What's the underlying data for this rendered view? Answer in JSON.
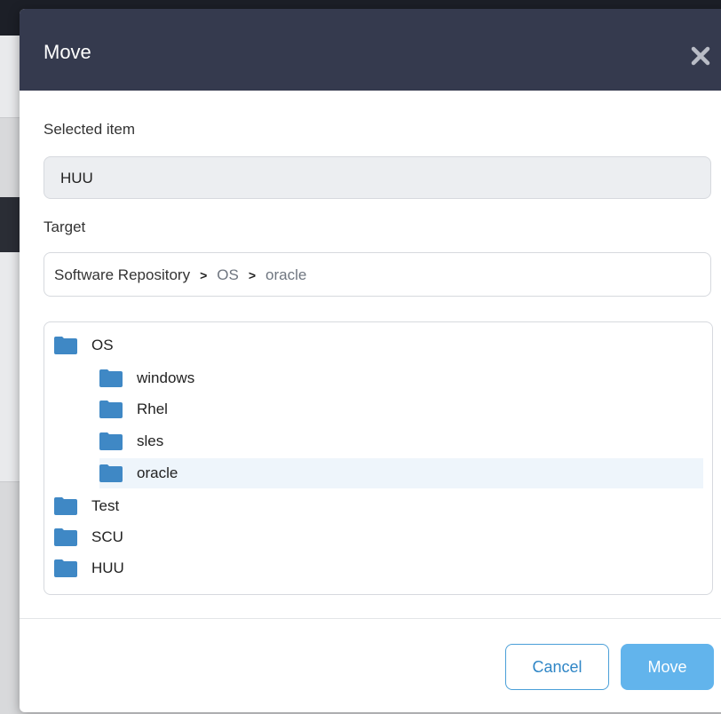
{
  "dialog": {
    "title": "Move",
    "close_icon": "close-icon"
  },
  "selected_item": {
    "label": "Selected item",
    "value": "HUU"
  },
  "target": {
    "label": "Target",
    "breadcrumb": [
      "Software Repository",
      "OS",
      "oracle"
    ],
    "separator": ">"
  },
  "tree": {
    "items": [
      {
        "label": "OS",
        "level": 0
      },
      {
        "label": "windows",
        "level": 1
      },
      {
        "label": "Rhel",
        "level": 1
      },
      {
        "label": "sles",
        "level": 1
      },
      {
        "label": "oracle",
        "level": 1,
        "selected": true
      },
      {
        "label": "Test",
        "level": 0
      },
      {
        "label": "SCU",
        "level": 0
      },
      {
        "label": "HUU",
        "level": 0
      }
    ]
  },
  "footer": {
    "cancel_label": "Cancel",
    "move_label": "Move"
  },
  "colors": {
    "header_bg": "#353a4e",
    "folder": "#3f88c5",
    "primary_button": "#62b4ec",
    "selected_row": "#eef5fb"
  }
}
